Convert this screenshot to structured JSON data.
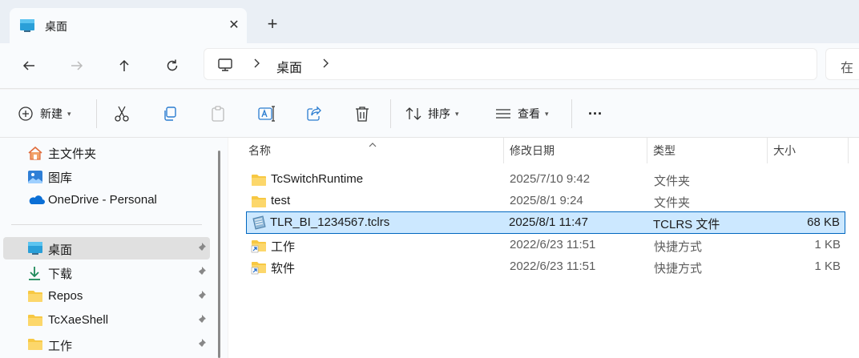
{
  "tab": {
    "title": "桌面",
    "close": "✕",
    "new_tab": "+"
  },
  "address": {
    "crumb": "桌面",
    "search_placeholder": "在"
  },
  "toolbar": {
    "new_label": "新建",
    "sort_label": "排序",
    "view_label": "查看",
    "more_label": "···"
  },
  "sidebar": {
    "top_items": [
      {
        "label": "主文件夹",
        "icon": "home-icon"
      },
      {
        "label": "图库",
        "icon": "gallery-icon"
      },
      {
        "label": "OneDrive - Personal",
        "icon": "onedrive-icon"
      }
    ],
    "pinned_items": [
      {
        "label": "桌面",
        "icon": "desktop-icon",
        "selected": true
      },
      {
        "label": "下载",
        "icon": "download-icon"
      },
      {
        "label": "Repos",
        "icon": "folder-icon"
      },
      {
        "label": "TcXaeShell",
        "icon": "folder-icon"
      },
      {
        "label": "工作",
        "icon": "folder-icon"
      }
    ]
  },
  "columns": {
    "name": "名称",
    "modified": "修改日期",
    "type": "类型",
    "size": "大小"
  },
  "files": [
    {
      "name": "TcSwitchRuntime",
      "modified": "2025/7/10 9:42",
      "type": "文件夹",
      "size": "",
      "icon": "folder-icon"
    },
    {
      "name": "test",
      "modified": "2025/8/1 9:24",
      "type": "文件夹",
      "size": "",
      "icon": "folder-icon"
    },
    {
      "name": "TLR_BI_1234567.tclrs",
      "modified": "2025/8/1 11:47",
      "type": "TCLRS 文件",
      "size": "68 KB",
      "icon": "file-icon",
      "selected": true
    },
    {
      "name": "工作",
      "modified": "2022/6/23 11:51",
      "type": "快捷方式",
      "size": "1 KB",
      "icon": "shortcut-folder-icon"
    },
    {
      "name": "软件",
      "modified": "2022/6/23 11:51",
      "type": "快捷方式",
      "size": "1 KB",
      "icon": "shortcut-folder-icon"
    }
  ],
  "colors": {
    "accent": "#0067c0",
    "selection": "#cce8ff",
    "folder": "#f7c843"
  }
}
